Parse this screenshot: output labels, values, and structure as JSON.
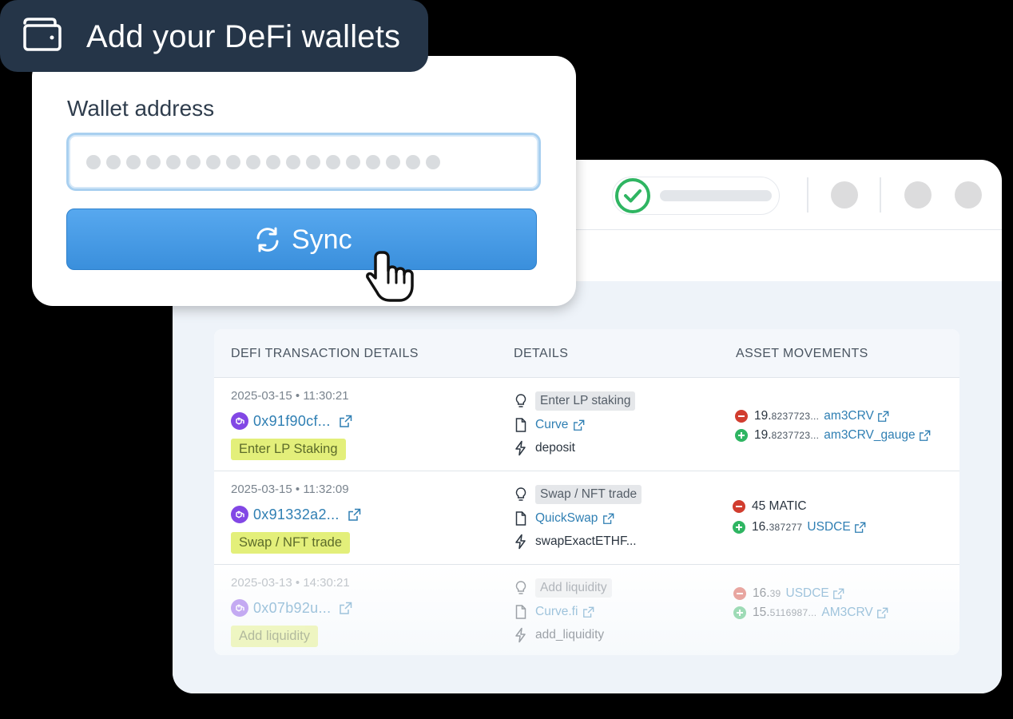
{
  "wallet_card": {
    "title": "Add your DeFi wallets",
    "field_label": "Wallet address",
    "input_masked_value": "●●●●●●●●●●●●●●●●●●",
    "sync_label": "Sync"
  },
  "table": {
    "headers": [
      "DEFI TRANSACTION DETAILS",
      "DETAILS",
      "ASSET MOVEMENTS"
    ],
    "rows": [
      {
        "date": "2025-03-15 • 11:30:21",
        "hash": "0x91f90cf...",
        "tag": "Enter LP Staking",
        "detail_action": "Enter LP staking",
        "detail_protocol": "Curve",
        "detail_method": "deposit",
        "movements": [
          {
            "sign": "minus",
            "int": "19.",
            "dec": "8237723...",
            "asset": "am3CRV",
            "link": true
          },
          {
            "sign": "plus",
            "int": "19.",
            "dec": "8237723...",
            "asset": "am3CRV_gauge",
            "link": true
          }
        ]
      },
      {
        "date": "2025-03-15 • 11:32:09",
        "hash": "0x91332a2...",
        "tag": "Swap / NFT trade",
        "detail_action": "Swap / NFT trade",
        "detail_protocol": "QuickSwap",
        "detail_method": "swapExactETHF...",
        "movements": [
          {
            "sign": "minus",
            "int": "45 MATIC",
            "dec": "",
            "asset": "",
            "link": false
          },
          {
            "sign": "plus",
            "int": "16.",
            "dec": "387277",
            "asset": "USDCE",
            "link": true
          }
        ]
      },
      {
        "date": "2025-03-13 • 14:30:21",
        "hash": "0x07b92u...",
        "tag": "Add liquidity",
        "detail_action": "Add liquidity",
        "detail_protocol": "Curve.fi",
        "detail_method": "add_liquidity",
        "movements": [
          {
            "sign": "minus",
            "int": "16.",
            "dec": "39",
            "asset": "USDCE",
            "link": true
          },
          {
            "sign": "plus",
            "int": "15.",
            "dec": "5116987...",
            "asset": "AM3CRV",
            "link": true
          }
        ]
      }
    ]
  },
  "colors": {
    "title_bg": "#253548",
    "sync_button": "#4a9be6",
    "link": "#2f7fb3",
    "tag": "#e3ef7a",
    "minus": "#d13d2f",
    "plus": "#2fb562",
    "status_ok": "#2fb562"
  },
  "icons": {
    "title": "wallet-icon",
    "sync": "refresh-icon",
    "status": "check-circle-icon",
    "chain": "polygon-icon",
    "action": "lightbulb-icon",
    "protocol": "document-icon",
    "method": "lightning-icon",
    "external": "external-link-icon",
    "cursor": "hand-pointer-icon"
  }
}
